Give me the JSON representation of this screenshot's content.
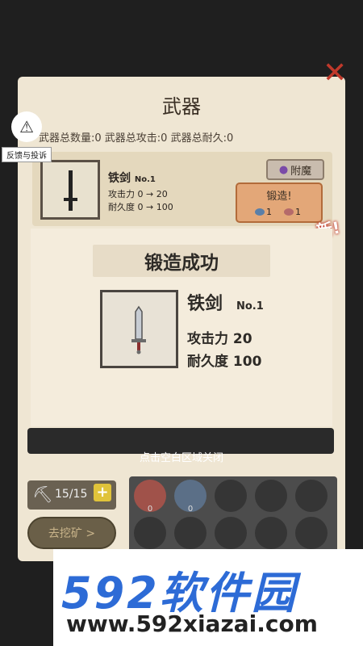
{
  "panel": {
    "title": "武器",
    "stats": "武器总数量:0  武器总攻击:0  武器总耐久:0",
    "weapon": {
      "name": "铁剑",
      "no": "No.1",
      "attack": "攻击力 0 → 20",
      "durability": "耐久度 0 → 100"
    },
    "enchant_label": "附魔",
    "forge_label": "锻造!",
    "ore_costs": [
      {
        "count": "1",
        "color": "#5a7fa8"
      },
      {
        "count": "1",
        "color": "#b56a6a"
      }
    ],
    "new_badge": "新!"
  },
  "feedback": {
    "label": "反馈与投诉"
  },
  "popup": {
    "title": "锻造成功",
    "item_name": "铁剑",
    "item_no": "No.1",
    "attack_line": "攻击力 20",
    "durability_line": "耐久度 100",
    "close_hint": "点击空白区域关闭"
  },
  "bottom": {
    "pickaxe_count": "15/15",
    "mine_button": "去挖矿 >",
    "ore_slots": [
      {
        "count": "0",
        "color": "#a0524a"
      },
      {
        "count": "0",
        "color": "#5b6f87"
      }
    ]
  },
  "watermark": {
    "brand": "592软件园",
    "url": "www.592xiazai.com"
  }
}
